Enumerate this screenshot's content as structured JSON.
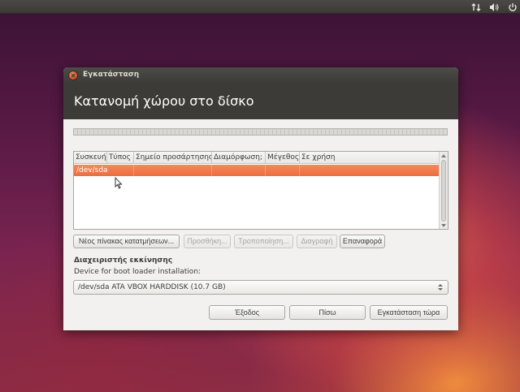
{
  "window": {
    "title": "Εγκατάσταση",
    "page_title": "Κατανομή χώρου στο δίσκο"
  },
  "table": {
    "columns": [
      "Συσκευή",
      "Τύπος",
      "Σημείο προσάρτησης",
      "Διαμόρφωση;",
      "Μέγεθος",
      "Σε χρήση"
    ],
    "rows": [
      {
        "device": "/dev/sda",
        "type": "",
        "mount": "",
        "format": "",
        "size": "",
        "used": ""
      }
    ]
  },
  "table_buttons": {
    "new_table": "Νέος πίνακας κατατμήσεων...",
    "add": "Προσθήκη...",
    "change": "Τροποποίηση...",
    "delete": "Διαγραφή",
    "revert": "Επαναφορά"
  },
  "bootloader": {
    "section_label": "Διαχειριστής εκκίνησης",
    "device_label": "Device for boot loader installation:",
    "selected_device": "/dev/sda ATA VBOX HARDDISK (10.7 GB)"
  },
  "footer_buttons": {
    "quit": "Έξοδος",
    "back": "Πίσω",
    "install": "Εγκατάσταση τώρα"
  },
  "colors": {
    "accent": "#ec6d3e",
    "header": "#3c3b37",
    "panel": "#3c3b37"
  },
  "panel": {
    "icons": [
      "network-transfer-icon",
      "volume-icon",
      "power-icon"
    ]
  }
}
